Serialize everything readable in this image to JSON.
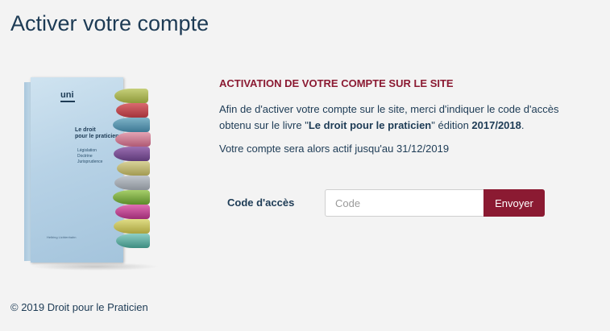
{
  "header": {
    "title": "Activer votre compte"
  },
  "book": {
    "logo": "uni",
    "title_line1": "Le droit",
    "title_line2": "pour le praticien",
    "subtitle_lines": [
      "Législation",
      "Doctrine",
      "Jurisprudence"
    ],
    "author": "Helbing Lichtenhahn"
  },
  "main": {
    "heading": "ACTIVATION DE VOTRE COMPTE SUR LE SITE",
    "instructions": {
      "part1": "Afin de d'activer votre compte sur le site, merci d'indiquer le code d'accès obtenu sur le livre \"",
      "book_title": "Le droit pour le praticien",
      "part2": "\" édition ",
      "edition": "2017/2018",
      "part3": "."
    },
    "validity": "Votre compte sera alors actif jusqu'au 31/12/2019"
  },
  "form": {
    "label": "Code d'accès",
    "placeholder": "Code",
    "value": "",
    "submit_label": "Envoyer"
  },
  "footer": {
    "copyright": "© 2019 Droit pour le Praticien"
  },
  "colors": {
    "title": "#1d3b55",
    "accent": "#8b1a32",
    "background": "#f3f3f3"
  }
}
